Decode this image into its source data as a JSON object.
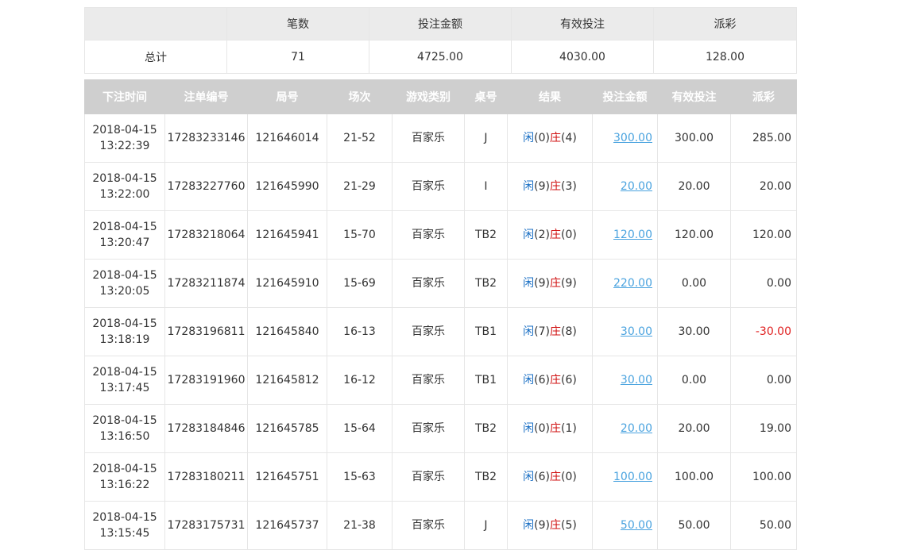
{
  "summary": {
    "headers": [
      "",
      "笔数",
      "投注金额",
      "有效投注",
      "派彩"
    ],
    "total_label": "总计",
    "count": "71",
    "bet_amount": "4725.00",
    "valid_bet": "4030.00",
    "payout": "128.00"
  },
  "detail": {
    "headers": [
      "下注时间",
      "注单编号",
      "局号",
      "场次",
      "游戏类别",
      "桌号",
      "结果",
      "投注金额",
      "有效投注",
      "派彩"
    ],
    "result_labels": {
      "player": "闲",
      "banker": "庄",
      "open": "(",
      "close": ")"
    },
    "rows": [
      {
        "date": "2018-04-15",
        "time": "13:22:39",
        "bet_no": "17283233146",
        "round_no": "121646014",
        "session": "21-52",
        "game": "百家乐",
        "table": "J",
        "player": "0",
        "banker": "4",
        "amount": "300.00",
        "valid": "300.00",
        "payout": "285.00",
        "negative": false
      },
      {
        "date": "2018-04-15",
        "time": "13:22:00",
        "bet_no": "17283227760",
        "round_no": "121645990",
        "session": "21-29",
        "game": "百家乐",
        "table": "I",
        "player": "9",
        "banker": "3",
        "amount": "20.00",
        "valid": "20.00",
        "payout": "20.00",
        "negative": false
      },
      {
        "date": "2018-04-15",
        "time": "13:20:47",
        "bet_no": "17283218064",
        "round_no": "121645941",
        "session": "15-70",
        "game": "百家乐",
        "table": "TB2",
        "player": "2",
        "banker": "0",
        "amount": "120.00",
        "valid": "120.00",
        "payout": "120.00",
        "negative": false
      },
      {
        "date": "2018-04-15",
        "time": "13:20:05",
        "bet_no": "17283211874",
        "round_no": "121645910",
        "session": "15-69",
        "game": "百家乐",
        "table": "TB2",
        "player": "9",
        "banker": "9",
        "amount": "220.00",
        "valid": "0.00",
        "payout": "0.00",
        "negative": false
      },
      {
        "date": "2018-04-15",
        "time": "13:18:19",
        "bet_no": "17283196811",
        "round_no": "121645840",
        "session": "16-13",
        "game": "百家乐",
        "table": "TB1",
        "player": "7",
        "banker": "8",
        "amount": "30.00",
        "valid": "30.00",
        "payout": "-30.00",
        "negative": true
      },
      {
        "date": "2018-04-15",
        "time": "13:17:45",
        "bet_no": "17283191960",
        "round_no": "121645812",
        "session": "16-12",
        "game": "百家乐",
        "table": "TB1",
        "player": "6",
        "banker": "6",
        "amount": "30.00",
        "valid": "0.00",
        "payout": "0.00",
        "negative": false
      },
      {
        "date": "2018-04-15",
        "time": "13:16:50",
        "bet_no": "17283184846",
        "round_no": "121645785",
        "session": "15-64",
        "game": "百家乐",
        "table": "TB2",
        "player": "0",
        "banker": "1",
        "amount": "20.00",
        "valid": "20.00",
        "payout": "19.00",
        "negative": false
      },
      {
        "date": "2018-04-15",
        "time": "13:16:22",
        "bet_no": "17283180211",
        "round_no": "121645751",
        "session": "15-63",
        "game": "百家乐",
        "table": "TB2",
        "player": "6",
        "banker": "0",
        "amount": "100.00",
        "valid": "100.00",
        "payout": "100.00",
        "negative": false
      },
      {
        "date": "2018-04-15",
        "time": "13:15:45",
        "bet_no": "17283175731",
        "round_no": "121645737",
        "session": "21-38",
        "game": "百家乐",
        "table": "J",
        "player": "9",
        "banker": "5",
        "amount": "50.00",
        "valid": "50.00",
        "payout": "50.00",
        "negative": false
      }
    ]
  }
}
